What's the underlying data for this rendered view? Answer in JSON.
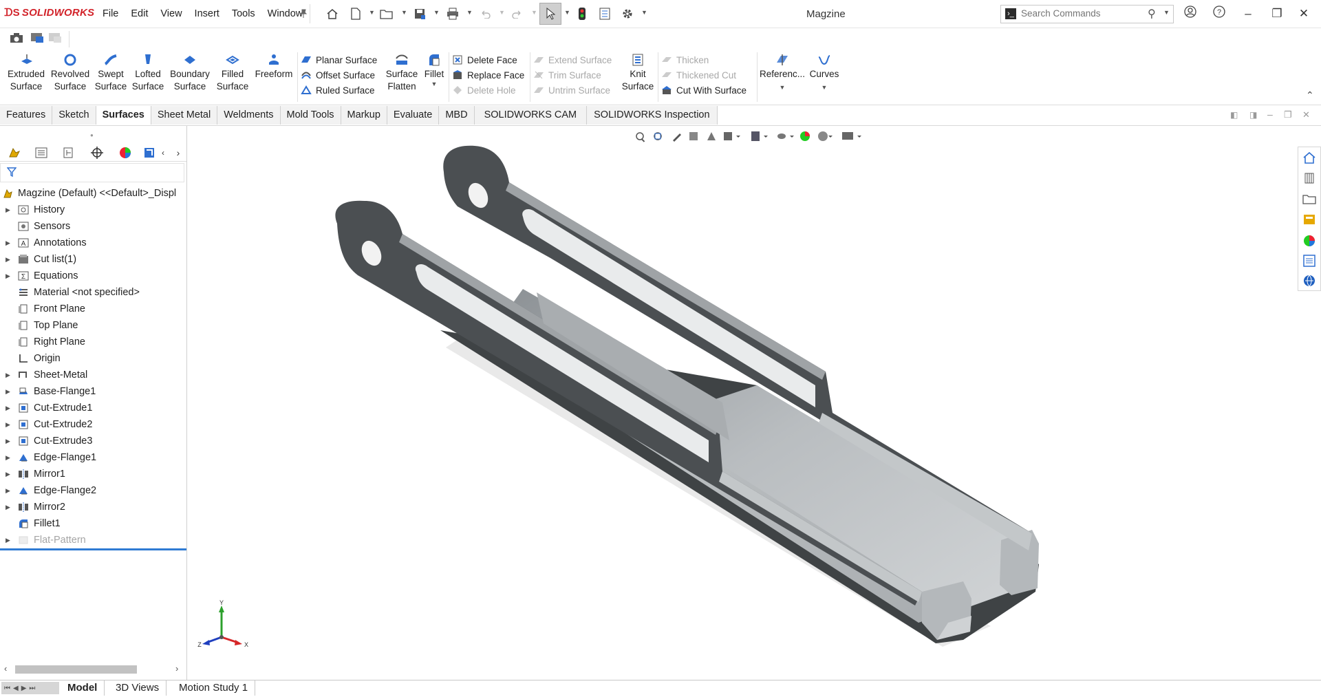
{
  "app": {
    "logo_text": "SOLIDWORKS",
    "document_title": "Magzine",
    "menus": [
      "File",
      "Edit",
      "View",
      "Insert",
      "Tools",
      "Window"
    ],
    "search": {
      "placeholder": "Search Commands"
    }
  },
  "ribbon": {
    "big": {
      "extruded_surface": "Extruded Surface",
      "revolved_surface": "Revolved Surface",
      "swept_surface": "Swept Surface",
      "lofted_surface": "Lofted Surface",
      "boundary_surface": "Boundary Surface",
      "filled_surface": "Filled Surface",
      "freeform": "Freeform",
      "surface_flatten": "Surface Flatten",
      "fillet": "Fillet",
      "knit_surface": "Knit Surface",
      "reference": "Referenc...",
      "curves": "Curves"
    },
    "small": {
      "planar_surface": "Planar Surface",
      "offset_surface": "Offset Surface",
      "ruled_surface": "Ruled Surface",
      "delete_face": "Delete Face",
      "replace_face": "Replace Face",
      "delete_hole": "Delete Hole",
      "extend_surface": "Extend Surface",
      "trim_surface": "Trim Surface",
      "untrim_surface": "Untrim Surface",
      "thicken": "Thicken",
      "thickened_cut": "Thickened Cut",
      "cut_with_surface": "Cut With Surface"
    }
  },
  "command_tabs": [
    "Features",
    "Sketch",
    "Surfaces",
    "Sheet Metal",
    "Weldments",
    "Mold Tools",
    "Markup",
    "Evaluate",
    "MBD",
    "SOLIDWORKS CAM",
    "SOLIDWORKS Inspection"
  ],
  "active_tab": "Surfaces",
  "tree": {
    "root": "Magzine (Default) <<Default>_Displ",
    "items": [
      {
        "label": "History",
        "icon": "history-icon",
        "expandable": true
      },
      {
        "label": "Sensors",
        "icon": "sensor-icon",
        "expandable": false
      },
      {
        "label": "Annotations",
        "icon": "annotations-icon",
        "expandable": true
      },
      {
        "label": "Cut list(1)",
        "icon": "cut-list-icon",
        "expandable": true
      },
      {
        "label": "Equations",
        "icon": "equations-icon",
        "expandable": true
      },
      {
        "label": "Material <not specified>",
        "icon": "material-icon",
        "expandable": false
      },
      {
        "label": "Front Plane",
        "icon": "plane-icon",
        "expandable": false
      },
      {
        "label": "Top Plane",
        "icon": "plane-icon",
        "expandable": false
      },
      {
        "label": "Right Plane",
        "icon": "plane-icon",
        "expandable": false
      },
      {
        "label": "Origin",
        "icon": "origin-icon",
        "expandable": false
      },
      {
        "label": "Sheet-Metal",
        "icon": "sheet-metal-icon",
        "expandable": true
      },
      {
        "label": "Base-Flange1",
        "icon": "base-flange-icon",
        "expandable": true
      },
      {
        "label": "Cut-Extrude1",
        "icon": "cut-extrude-icon",
        "expandable": true
      },
      {
        "label": "Cut-Extrude2",
        "icon": "cut-extrude-icon",
        "expandable": true
      },
      {
        "label": "Cut-Extrude3",
        "icon": "cut-extrude-icon",
        "expandable": true
      },
      {
        "label": "Edge-Flange1",
        "icon": "edge-flange-icon",
        "expandable": true
      },
      {
        "label": "Mirror1",
        "icon": "mirror-icon",
        "expandable": true
      },
      {
        "label": "Edge-Flange2",
        "icon": "edge-flange-icon",
        "expandable": true
      },
      {
        "label": "Mirror2",
        "icon": "mirror-icon",
        "expandable": true
      },
      {
        "label": "Fillet1",
        "icon": "fillet-icon",
        "expandable": false
      },
      {
        "label": "Flat-Pattern",
        "icon": "flat-pattern-icon",
        "expandable": true,
        "suppressed": true
      }
    ]
  },
  "triad": {
    "x": "X",
    "y": "Y",
    "z": "Z"
  },
  "bottom_tabs": [
    "Model",
    "3D Views",
    "Motion Study 1"
  ],
  "active_bottom_tab": "Model",
  "colors": {
    "accent_blue": "#1f6fd1",
    "brand_red": "#d2232a",
    "part_dark": "#4b4f52",
    "part_light": "#c7cbce"
  }
}
